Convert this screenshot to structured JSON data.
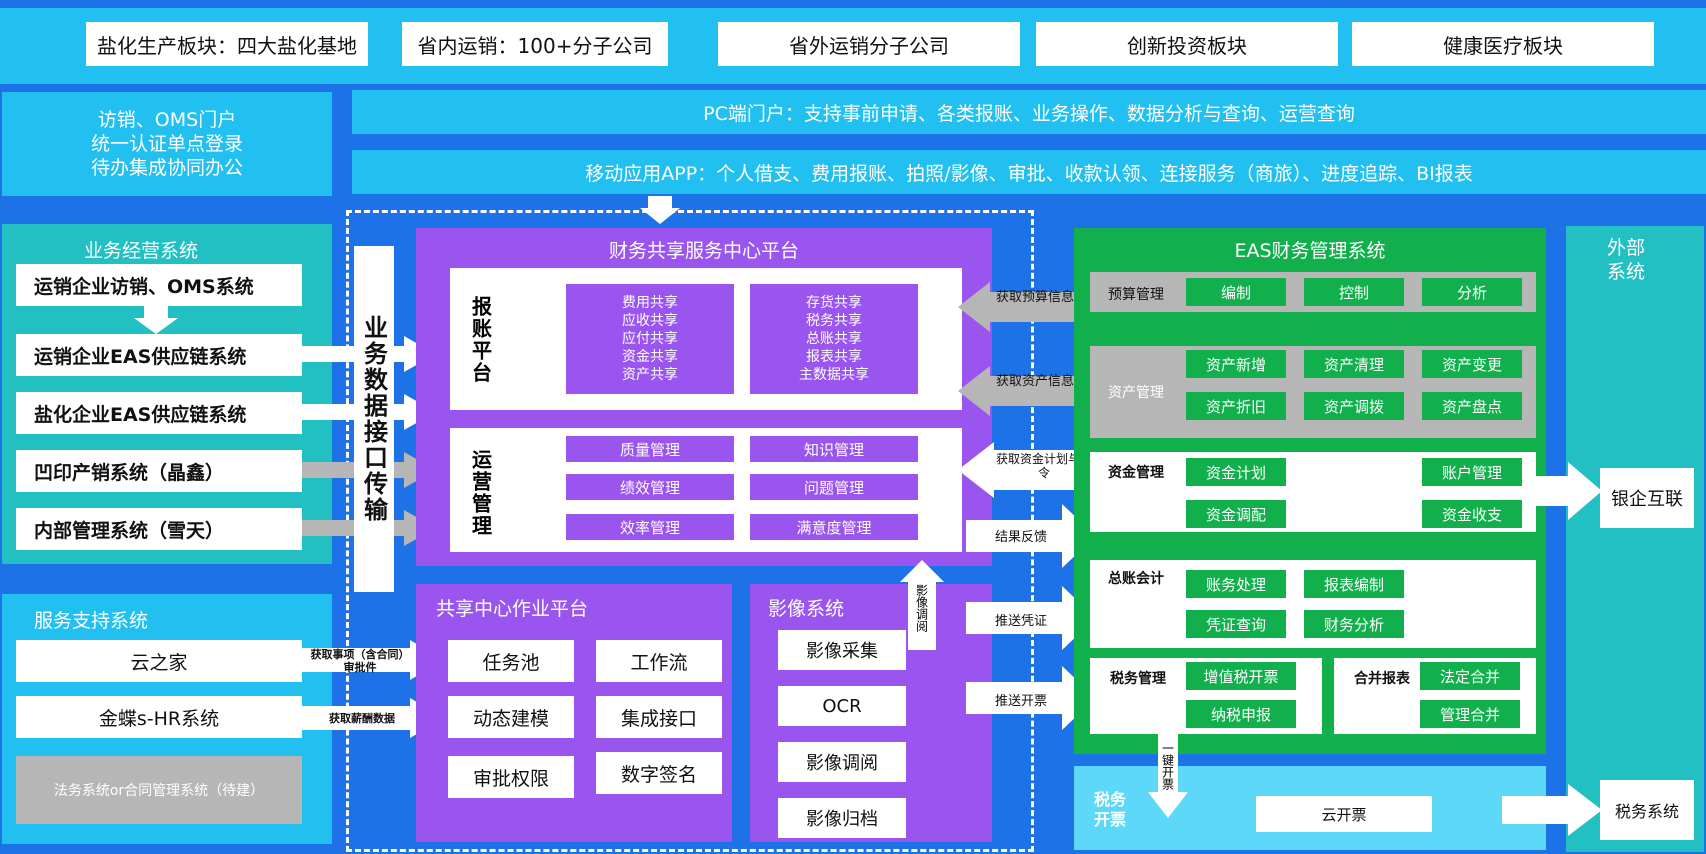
{
  "top_row": [
    "盐化生产板块：四大盐化基地",
    "省内运销：100+分子公司",
    "省外运销分子公司",
    "创新投资板块",
    "健康医疗板块"
  ],
  "portal_left": [
    "访销、OMS门户",
    "统一认证单点登录",
    "待办集成协同办公"
  ],
  "pc_portal": "PC端门户：支持事前申请、各类报账、业务操作、数据分析与查询、运营查询",
  "mobile_app": "移动应用APP：个人借支、费用报账、拍照/影像、审批、收款认领、连接服务（商旅）、进度追踪、BI报表",
  "biz_systems": {
    "title": "业务经营系统",
    "items": [
      "运销企业访销、OMS系统",
      "运销企业EAS供应链系统",
      "盐化企业EAS供应链系统",
      "凹印产销系统（晶鑫）",
      "内部管理系统（雪天）"
    ]
  },
  "interface": "业务数据接口传输",
  "service_systems": {
    "title": "服务支持系统",
    "items": [
      "云之家",
      "金蝶s-HR系统",
      "法务系统or合同管理系统（待建）"
    ],
    "flow1": "获取事项（含合同）审批件",
    "flow2": "获取薪酬数据"
  },
  "fssc": {
    "title": "财务共享服务中心平台",
    "reimburse_label": "报账平台",
    "reimburse_col1": [
      "费用共享",
      "应收共享",
      "应付共享",
      "资金共享",
      "资产共享"
    ],
    "reimburse_col2": [
      "存货共享",
      "税务共享",
      "总账共享",
      "报表共享",
      "主数据共享"
    ],
    "ops_label": "运营管理",
    "ops_items": [
      "质量管理",
      "知识管理",
      "绩效管理",
      "问题管理",
      "效率管理",
      "满意度管理"
    ]
  },
  "work_platform": {
    "title": "共享中心作业平台",
    "items": [
      "任务池",
      "工作流",
      "动态建模",
      "集成接口",
      "审批权限",
      "数字签名"
    ]
  },
  "image_system": {
    "title": "影像系统",
    "items": [
      "影像采集",
      "OCR",
      "影像调阅",
      "影像归档"
    ],
    "arrow_label": "影像调阅"
  },
  "flow_labels": [
    "获取预算信息",
    "获取资产信息",
    "获取资金计划与指令",
    "结果反馈",
    "推送凭证",
    "推送开票"
  ],
  "eas": {
    "title": "EAS财务管理系统",
    "budget": {
      "label": "预算管理",
      "items": [
        "编制",
        "控制",
        "分析"
      ]
    },
    "asset": {
      "label": "资产管理",
      "items": [
        "资产新增",
        "资产清理",
        "资产变更",
        "资产折旧",
        "资产调拨",
        "资产盘点"
      ]
    },
    "fund": {
      "label": "资金管理",
      "items": [
        "资金计划",
        "账户管理",
        "资金调配",
        "资金收支"
      ]
    },
    "ledger": {
      "label": "总账会计",
      "items": [
        "账务处理",
        "报表编制",
        "凭证查询",
        "财务分析"
      ]
    },
    "tax": {
      "label": "税务管理",
      "items": [
        "增值税开票",
        "纳税申报"
      ]
    },
    "consolidation": {
      "label": "合并报表",
      "items": [
        "法定合并",
        "管理合并"
      ]
    }
  },
  "one_click": "一键开票",
  "tax_invoice": {
    "label": "税务开票",
    "cloud": "云开票"
  },
  "external": {
    "title": "外部系统",
    "bank": "银企互联",
    "tax": "税务系统"
  }
}
